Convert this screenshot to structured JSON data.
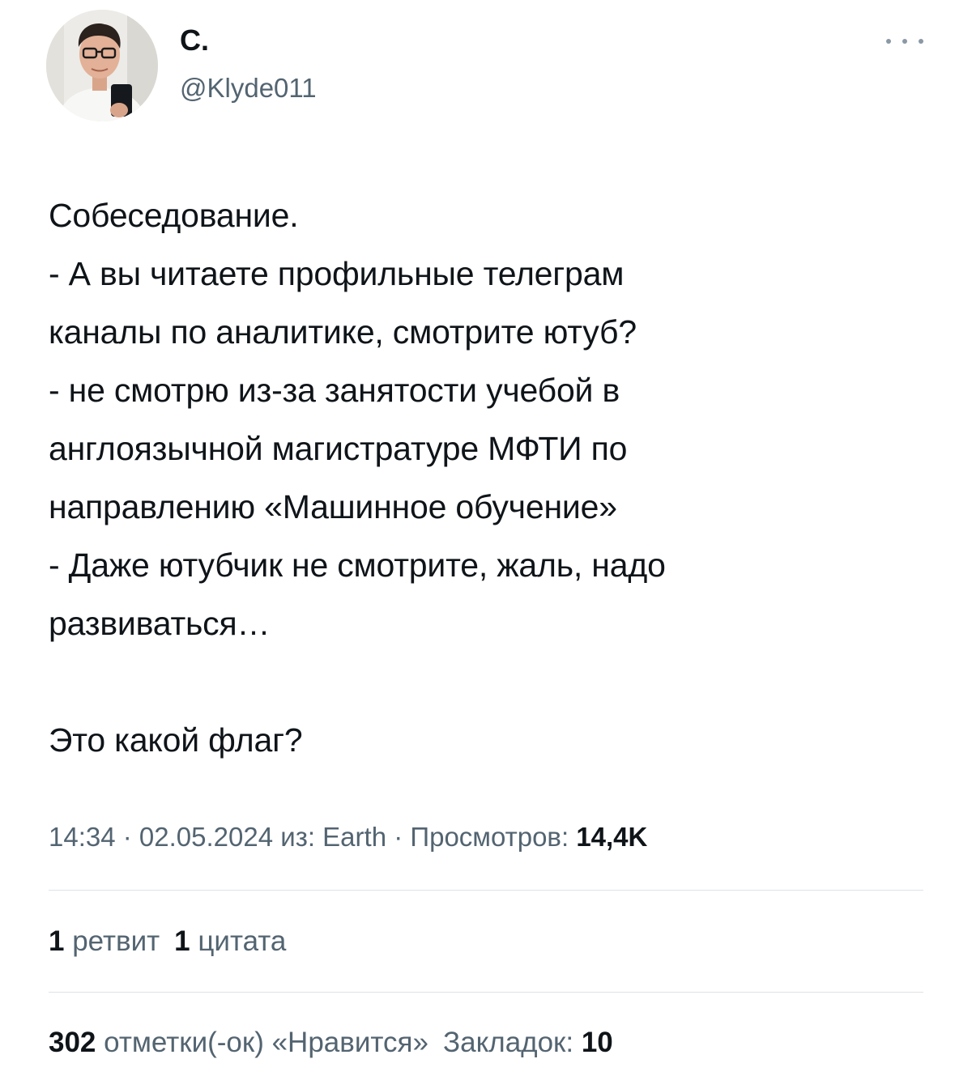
{
  "author": {
    "name": "С.",
    "handle": "@Klyde011"
  },
  "tweet": {
    "lines": [
      "Собеседование.",
      "- А вы читаете профильные телеграм",
      "каналы по аналитике, смотрите ютуб?",
      "- не смотрю из-за занятости учебой в",
      "англоязычной магистратуре МФТИ по",
      "направлению «Машинное обучение»",
      "- Даже ютубчик не смотрите, жаль, надо",
      "развиваться…",
      "",
      "Это какой флаг?"
    ]
  },
  "meta": {
    "time": "14:34",
    "separator": " · ",
    "date": "02.05.2024",
    "source_prefix": " из: ",
    "source": "Earth",
    "views_label": "Просмотров: ",
    "views_count": "14,4K"
  },
  "stats": {
    "retweets_count": "1",
    "retweets_label": " ретвит",
    "quotes_count": "1",
    "quotes_label": " цитата",
    "likes_count": "302",
    "likes_label": " отметки(-ок) «Нравится»",
    "bookmarks_label": "Закладок: ",
    "bookmarks_count": "10"
  },
  "icons": {
    "more": "more-horizontal-icon"
  },
  "colors": {
    "text_primary": "#0f1419",
    "text_secondary": "#536471",
    "divider": "#dfe3e7"
  }
}
